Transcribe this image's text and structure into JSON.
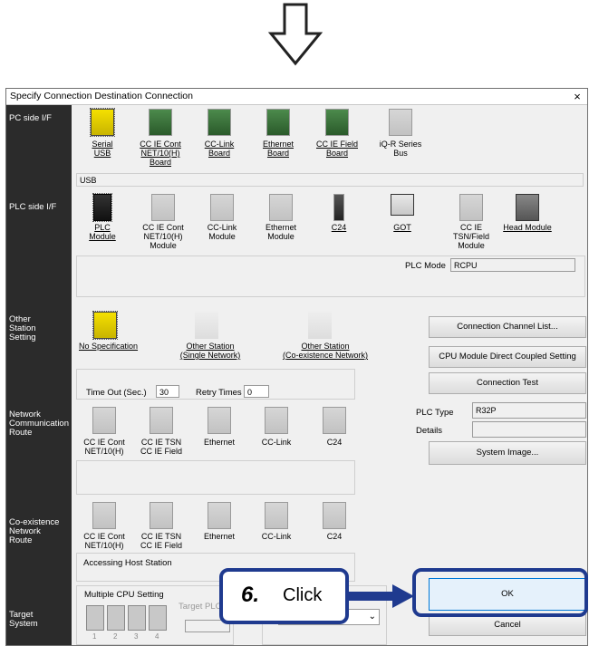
{
  "dialog": {
    "title": "Specify Connection Destination Connection",
    "close": "×"
  },
  "sections": {
    "pc_side": "PC side I/F",
    "plc_side": "PLC side I/F",
    "other_station": [
      "Other",
      "Station",
      "Setting"
    ],
    "network_route": [
      "Network",
      "Communication",
      "Route"
    ],
    "coexist_route": [
      "Co-existence",
      "Network",
      "Route"
    ],
    "target_system": [
      "Target",
      "System"
    ]
  },
  "pc_side": {
    "items": [
      [
        "Serial",
        "USB"
      ],
      [
        "CC IE Cont",
        "NET/10(H)",
        "Board"
      ],
      [
        "CC-Link",
        "Board"
      ],
      [
        "Ethernet",
        "Board"
      ],
      [
        "CC IE Field",
        "Board"
      ],
      [
        "iQ-R Series",
        "Bus"
      ]
    ],
    "selected_text": "USB"
  },
  "plc_side": {
    "items": [
      [
        "PLC",
        "Module"
      ],
      [
        "CC IE Cont",
        "NET/10(H)",
        "Module"
      ],
      [
        "CC-Link",
        "Module"
      ],
      [
        "Ethernet",
        "Module"
      ],
      [
        "C24"
      ],
      [
        "GOT"
      ],
      [
        "CC IE",
        "TSN/Field",
        "Module"
      ],
      [
        "Head Module"
      ]
    ],
    "plc_mode_label": "PLC Mode",
    "plc_mode_value": "RCPU"
  },
  "other_station": {
    "items": [
      [
        "No Specification"
      ],
      [
        "Other Station",
        "(Single Network)"
      ],
      [
        "Other Station",
        "(Co-existence Network)"
      ]
    ],
    "timeout_label": "Time Out (Sec.)",
    "timeout_value": "30",
    "retry_label": "Retry Times",
    "retry_value": "0"
  },
  "network_route": {
    "items": [
      [
        "CC IE Cont",
        "NET/10(H)"
      ],
      [
        "CC IE TSN",
        "CC IE Field"
      ],
      [
        "Ethernet"
      ],
      [
        "CC-Link"
      ],
      [
        "C24"
      ]
    ]
  },
  "coexist_route": {
    "items": [
      [
        "CC IE Cont",
        "NET/10(H)"
      ],
      [
        "CC IE TSN",
        "CC IE Field"
      ],
      [
        "Ethernet"
      ],
      [
        "CC-Link"
      ],
      [
        "C24"
      ]
    ],
    "status_text": "Accessing Host Station"
  },
  "target": {
    "multi_cpu_label": "Multiple CPU Setting",
    "target_plc_label": "Target PLC",
    "cpu_numbers": [
      "1",
      "2",
      "3",
      "4"
    ]
  },
  "right_panel": {
    "channel_list": "Connection Channel List...",
    "direct_coupled": "CPU Module Direct Coupled Setting",
    "connection_test": "Connection Test",
    "plc_type_label": "PLC Type",
    "plc_type_value": "R32P",
    "details_label": "Details",
    "details_value": "",
    "system_image": "System Image...",
    "ok": "OK",
    "cancel": "Cancel"
  },
  "callout": {
    "step": "6.",
    "text": "Click"
  },
  "colors": {
    "callout_border": "#1f3a8f",
    "arrow": "#1f3a8f",
    "left_column": "#2b2b2b",
    "ok_border": "#0078d7"
  }
}
